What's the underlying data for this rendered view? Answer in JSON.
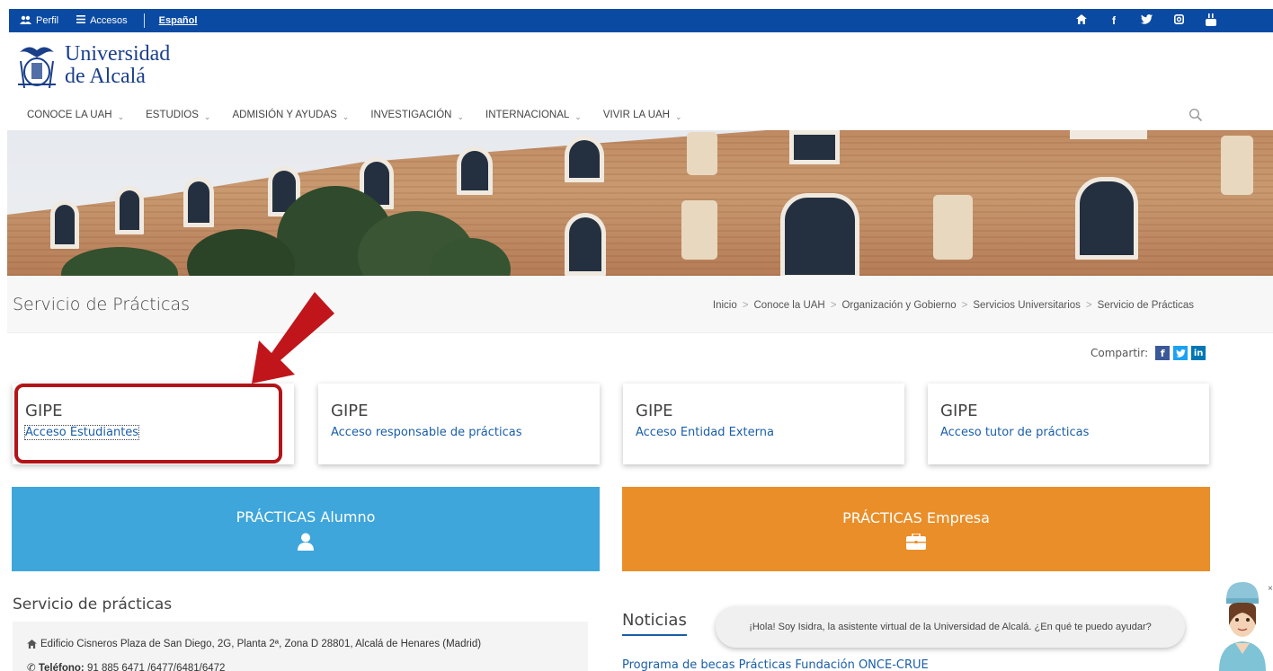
{
  "topbar": {
    "perfil": "Perfil",
    "accesos": "Accesos",
    "lang": "Español"
  },
  "logo": {
    "line1": "Universidad",
    "line2": "de Alcalá"
  },
  "nav": {
    "items": [
      "CONOCE LA UAH",
      "ESTUDIOS",
      "ADMISIÓN Y AYUDAS",
      "INVESTIGACIÓN",
      "INTERNACIONAL",
      "VIVIR LA UAH"
    ]
  },
  "page": {
    "title": "Servicio de Prácticas",
    "breadcrumb": [
      "Inicio",
      "Conoce la UAH",
      "Organización y Gobierno",
      "Servicios Universitarios",
      "Servicio de Prácticas"
    ],
    "share_label": "Compartir:"
  },
  "cards": [
    {
      "title": "GIPE",
      "link": "Acceso Estudiantes"
    },
    {
      "title": "GIPE",
      "link": "Acceso responsable de prácticas"
    },
    {
      "title": "GIPE",
      "link": "Acceso Entidad Externa"
    },
    {
      "title": "GIPE",
      "link": "Acceso tutor de prácticas"
    }
  ],
  "buttons": {
    "alumno": "PRÁCTICAS Alumno",
    "empresa": "PRÁCTICAS Empresa"
  },
  "servicio": {
    "heading": "Servicio de prácticas",
    "address": "Edificio Cisneros Plaza de San Diego, 2G, Planta 2ª, Zona D 28801, Alcalá de Henares (Madrid)",
    "phone_label": "Teléfono:",
    "phone_value": "91 885 6471 /6477/6481/6472"
  },
  "noticias": {
    "heading": "Noticias",
    "item1": "Programa de becas Prácticas Fundación ONCE-CRUE"
  },
  "chat": {
    "message": "¡Hola! Soy Isidra, la asistente virtual de la Universidad de Alcalá. ¿En qué te puedo ayudar?"
  },
  "colors": {
    "topbar": "#0b4aa2",
    "alumno": "#3ea6db",
    "empresa": "#e98e29",
    "highlight": "#b31418",
    "link": "#1a5ea8"
  }
}
